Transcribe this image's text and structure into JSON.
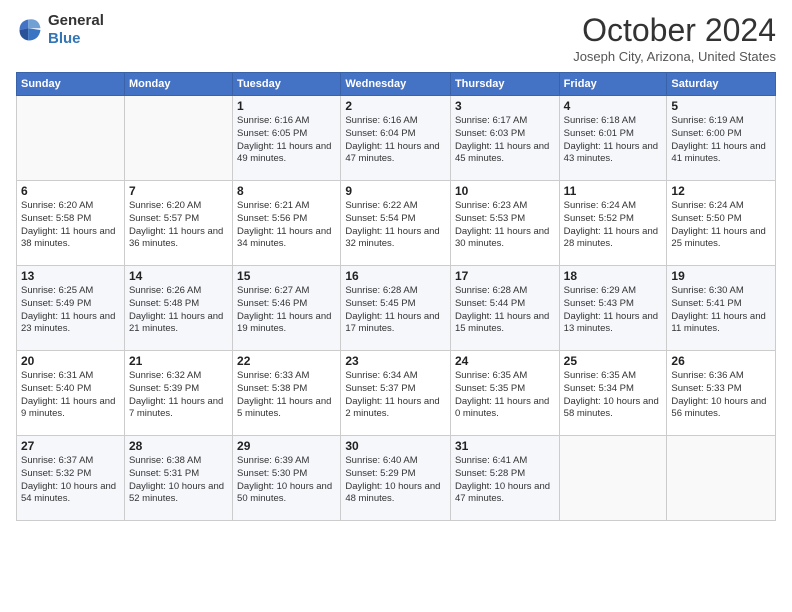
{
  "branding": {
    "general": "General",
    "blue": "Blue"
  },
  "header": {
    "title": "October 2024",
    "location": "Joseph City, Arizona, United States"
  },
  "columns": [
    "Sunday",
    "Monday",
    "Tuesday",
    "Wednesday",
    "Thursday",
    "Friday",
    "Saturday"
  ],
  "weeks": [
    [
      null,
      null,
      {
        "day": 1,
        "sunrise": "6:16 AM",
        "sunset": "6:05 PM",
        "daylight": "11 hours and 49 minutes."
      },
      {
        "day": 2,
        "sunrise": "6:16 AM",
        "sunset": "6:04 PM",
        "daylight": "11 hours and 47 minutes."
      },
      {
        "day": 3,
        "sunrise": "6:17 AM",
        "sunset": "6:03 PM",
        "daylight": "11 hours and 45 minutes."
      },
      {
        "day": 4,
        "sunrise": "6:18 AM",
        "sunset": "6:01 PM",
        "daylight": "11 hours and 43 minutes."
      },
      {
        "day": 5,
        "sunrise": "6:19 AM",
        "sunset": "6:00 PM",
        "daylight": "11 hours and 41 minutes."
      }
    ],
    [
      {
        "day": 6,
        "sunrise": "6:20 AM",
        "sunset": "5:58 PM",
        "daylight": "11 hours and 38 minutes."
      },
      {
        "day": 7,
        "sunrise": "6:20 AM",
        "sunset": "5:57 PM",
        "daylight": "11 hours and 36 minutes."
      },
      {
        "day": 8,
        "sunrise": "6:21 AM",
        "sunset": "5:56 PM",
        "daylight": "11 hours and 34 minutes."
      },
      {
        "day": 9,
        "sunrise": "6:22 AM",
        "sunset": "5:54 PM",
        "daylight": "11 hours and 32 minutes."
      },
      {
        "day": 10,
        "sunrise": "6:23 AM",
        "sunset": "5:53 PM",
        "daylight": "11 hours and 30 minutes."
      },
      {
        "day": 11,
        "sunrise": "6:24 AM",
        "sunset": "5:52 PM",
        "daylight": "11 hours and 28 minutes."
      },
      {
        "day": 12,
        "sunrise": "6:24 AM",
        "sunset": "5:50 PM",
        "daylight": "11 hours and 25 minutes."
      }
    ],
    [
      {
        "day": 13,
        "sunrise": "6:25 AM",
        "sunset": "5:49 PM",
        "daylight": "11 hours and 23 minutes."
      },
      {
        "day": 14,
        "sunrise": "6:26 AM",
        "sunset": "5:48 PM",
        "daylight": "11 hours and 21 minutes."
      },
      {
        "day": 15,
        "sunrise": "6:27 AM",
        "sunset": "5:46 PM",
        "daylight": "11 hours and 19 minutes."
      },
      {
        "day": 16,
        "sunrise": "6:28 AM",
        "sunset": "5:45 PM",
        "daylight": "11 hours and 17 minutes."
      },
      {
        "day": 17,
        "sunrise": "6:28 AM",
        "sunset": "5:44 PM",
        "daylight": "11 hours and 15 minutes."
      },
      {
        "day": 18,
        "sunrise": "6:29 AM",
        "sunset": "5:43 PM",
        "daylight": "11 hours and 13 minutes."
      },
      {
        "day": 19,
        "sunrise": "6:30 AM",
        "sunset": "5:41 PM",
        "daylight": "11 hours and 11 minutes."
      }
    ],
    [
      {
        "day": 20,
        "sunrise": "6:31 AM",
        "sunset": "5:40 PM",
        "daylight": "11 hours and 9 minutes."
      },
      {
        "day": 21,
        "sunrise": "6:32 AM",
        "sunset": "5:39 PM",
        "daylight": "11 hours and 7 minutes."
      },
      {
        "day": 22,
        "sunrise": "6:33 AM",
        "sunset": "5:38 PM",
        "daylight": "11 hours and 5 minutes."
      },
      {
        "day": 23,
        "sunrise": "6:34 AM",
        "sunset": "5:37 PM",
        "daylight": "11 hours and 2 minutes."
      },
      {
        "day": 24,
        "sunrise": "6:35 AM",
        "sunset": "5:35 PM",
        "daylight": "11 hours and 0 minutes."
      },
      {
        "day": 25,
        "sunrise": "6:35 AM",
        "sunset": "5:34 PM",
        "daylight": "10 hours and 58 minutes."
      },
      {
        "day": 26,
        "sunrise": "6:36 AM",
        "sunset": "5:33 PM",
        "daylight": "10 hours and 56 minutes."
      }
    ],
    [
      {
        "day": 27,
        "sunrise": "6:37 AM",
        "sunset": "5:32 PM",
        "daylight": "10 hours and 54 minutes."
      },
      {
        "day": 28,
        "sunrise": "6:38 AM",
        "sunset": "5:31 PM",
        "daylight": "10 hours and 52 minutes."
      },
      {
        "day": 29,
        "sunrise": "6:39 AM",
        "sunset": "5:30 PM",
        "daylight": "10 hours and 50 minutes."
      },
      {
        "day": 30,
        "sunrise": "6:40 AM",
        "sunset": "5:29 PM",
        "daylight": "10 hours and 48 minutes."
      },
      {
        "day": 31,
        "sunrise": "6:41 AM",
        "sunset": "5:28 PM",
        "daylight": "10 hours and 47 minutes."
      },
      null,
      null
    ]
  ]
}
